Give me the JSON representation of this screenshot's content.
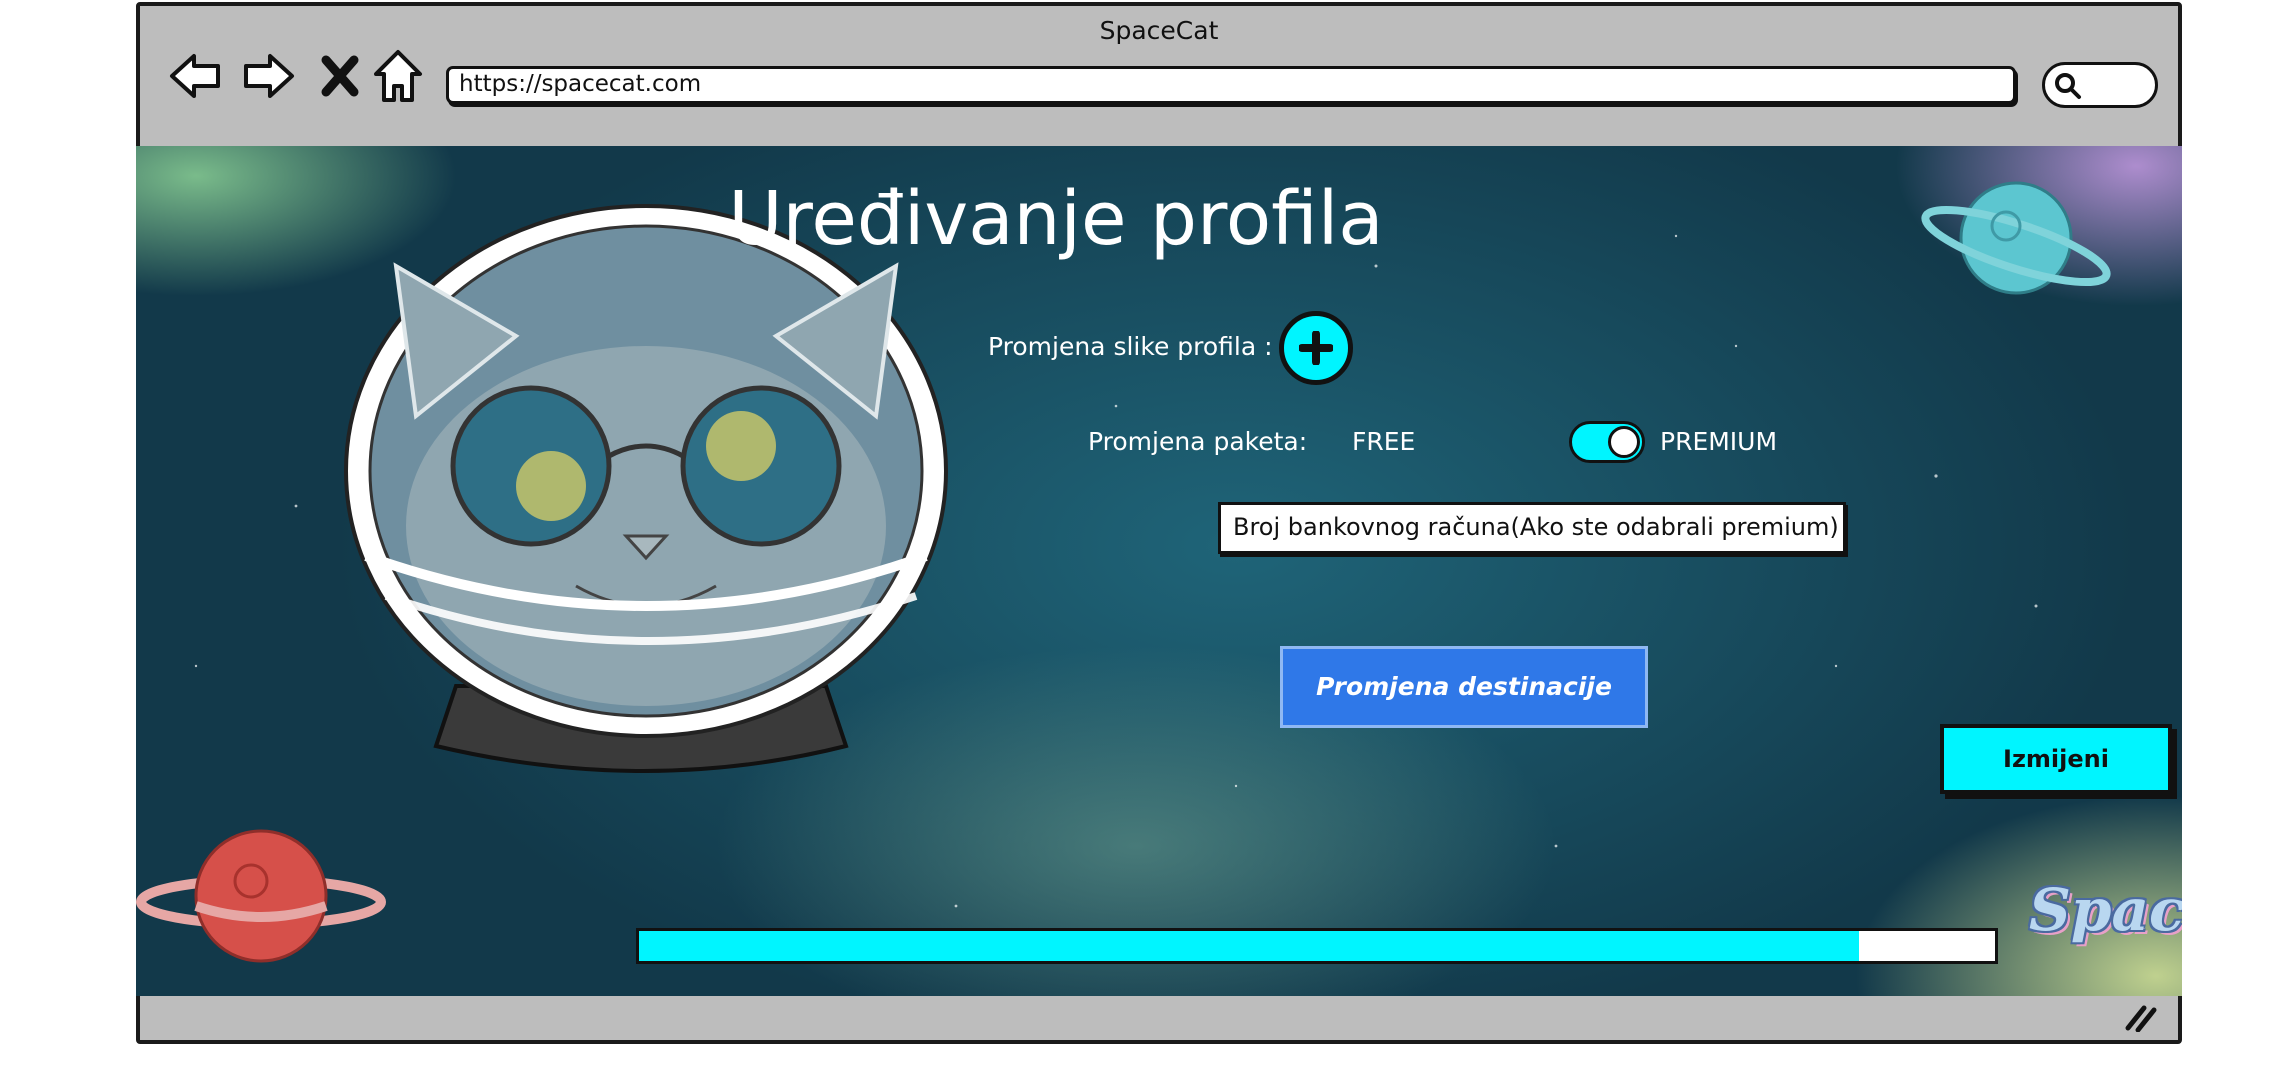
{
  "window": {
    "title": "SpaceCat"
  },
  "toolbar": {
    "url": "https://spacecat.com",
    "icons": [
      "back-arrow-icon",
      "forward-arrow-icon",
      "close-icon",
      "home-icon",
      "search-icon"
    ]
  },
  "page": {
    "heading": "Uređivanje profila",
    "profile_image_label": "Promjena slike profila :",
    "package_label": "Promjena paketa:",
    "package_free": "FREE",
    "package_premium": "PREMIUM",
    "package_premium_selected": true,
    "bank_account_field": "Broj bankovnog računa(Ako ste odabrali premium)",
    "destination_button": "Promjena destinacije",
    "submit_button": "Izmijeni",
    "progress": 0.9,
    "logo_text": "SpaceCat"
  },
  "colors": {
    "accent": "#00f5ff",
    "button_blue": "#2f78e8",
    "chrome_gray": "#bdbdbd"
  }
}
